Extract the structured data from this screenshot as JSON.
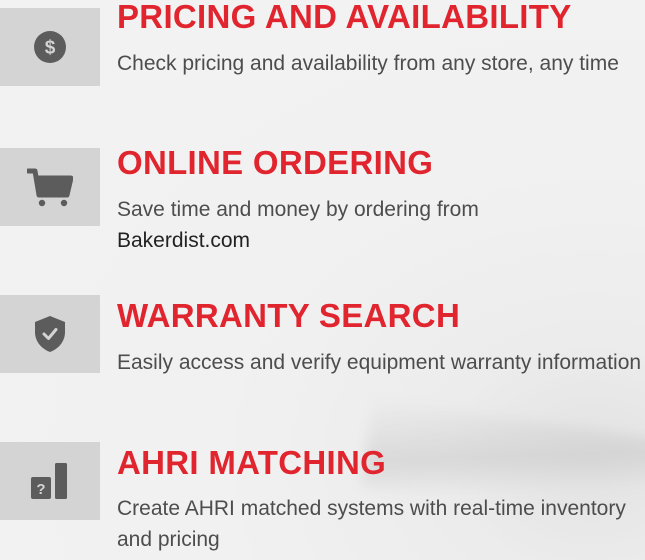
{
  "features": [
    {
      "icon": "dollar-icon",
      "title": "PRICING AND AVAILABILITY",
      "description": "Check pricing and availability from any store, any time"
    },
    {
      "icon": "cart-icon",
      "title": "ONLINE ORDERING",
      "description": "Save time and money by ordering from",
      "link_text": "Bakerdist.com"
    },
    {
      "icon": "shield-check-icon",
      "title": "WARRANTY SEARCH",
      "description": "Easily access and verify equipment warranty information"
    },
    {
      "icon": "matching-chart-icon",
      "title": "AHRI MATCHING",
      "description": "Create AHRI matched systems with real-time inventory and pricing"
    }
  ],
  "colors": {
    "accent": "#e1252f",
    "icon": "#5c5c5c",
    "icon_box": "#d4d4d4",
    "text": "#4d4d4d"
  }
}
